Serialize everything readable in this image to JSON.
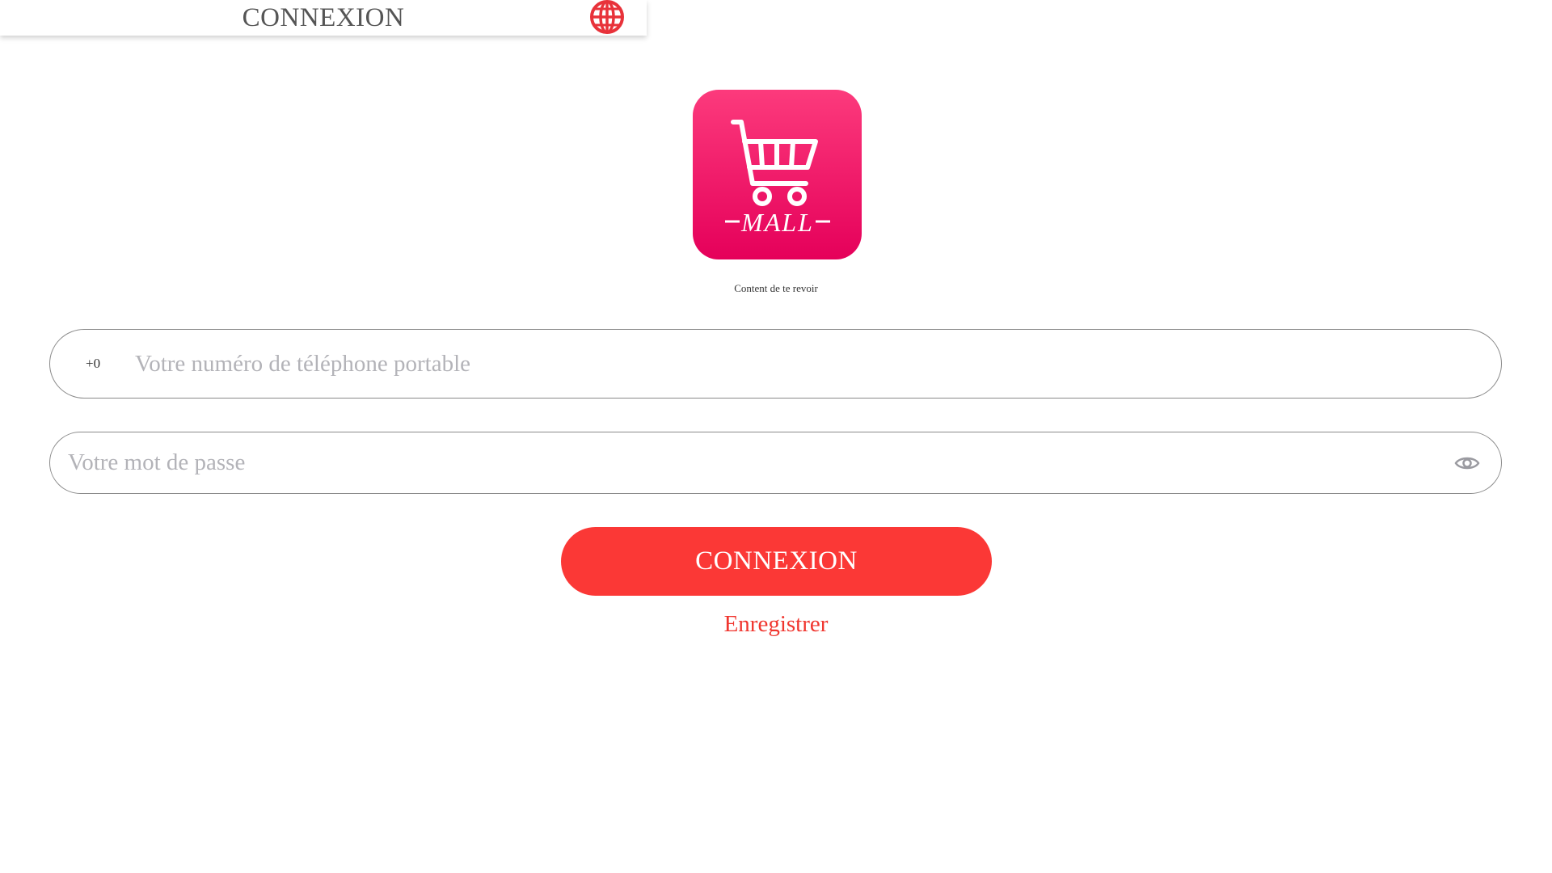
{
  "header": {
    "title": "CONNEXION",
    "language_icon": "globe-icon",
    "accent_color": "#e8323a"
  },
  "logo": {
    "icon": "shopping-cart-icon",
    "text": "MALL",
    "gradient_top": "#fc3a7c",
    "gradient_bottom": "#e5005a"
  },
  "tagline": "Content de te revoir",
  "phone": {
    "country_code": "+0",
    "placeholder": "Votre numéro de téléphone portable",
    "value": ""
  },
  "password": {
    "placeholder": "Votre mot de passe",
    "value": "",
    "toggle_icon": "eye-icon"
  },
  "login_button": {
    "label": "CONNEXION",
    "color": "#fb3836"
  },
  "register_link": {
    "label": "Enregistrer",
    "color": "#f0362f"
  }
}
